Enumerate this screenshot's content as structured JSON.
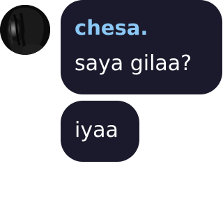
{
  "chat": {
    "avatar_icon": "person-silhouette-avatar",
    "bubble_color": "#1b1a2c",
    "author_color": "#8bc8f5",
    "messages": [
      {
        "author": "chesa.",
        "text": "saya gilaa?"
      },
      {
        "author": "",
        "text": "iyaa"
      }
    ]
  }
}
